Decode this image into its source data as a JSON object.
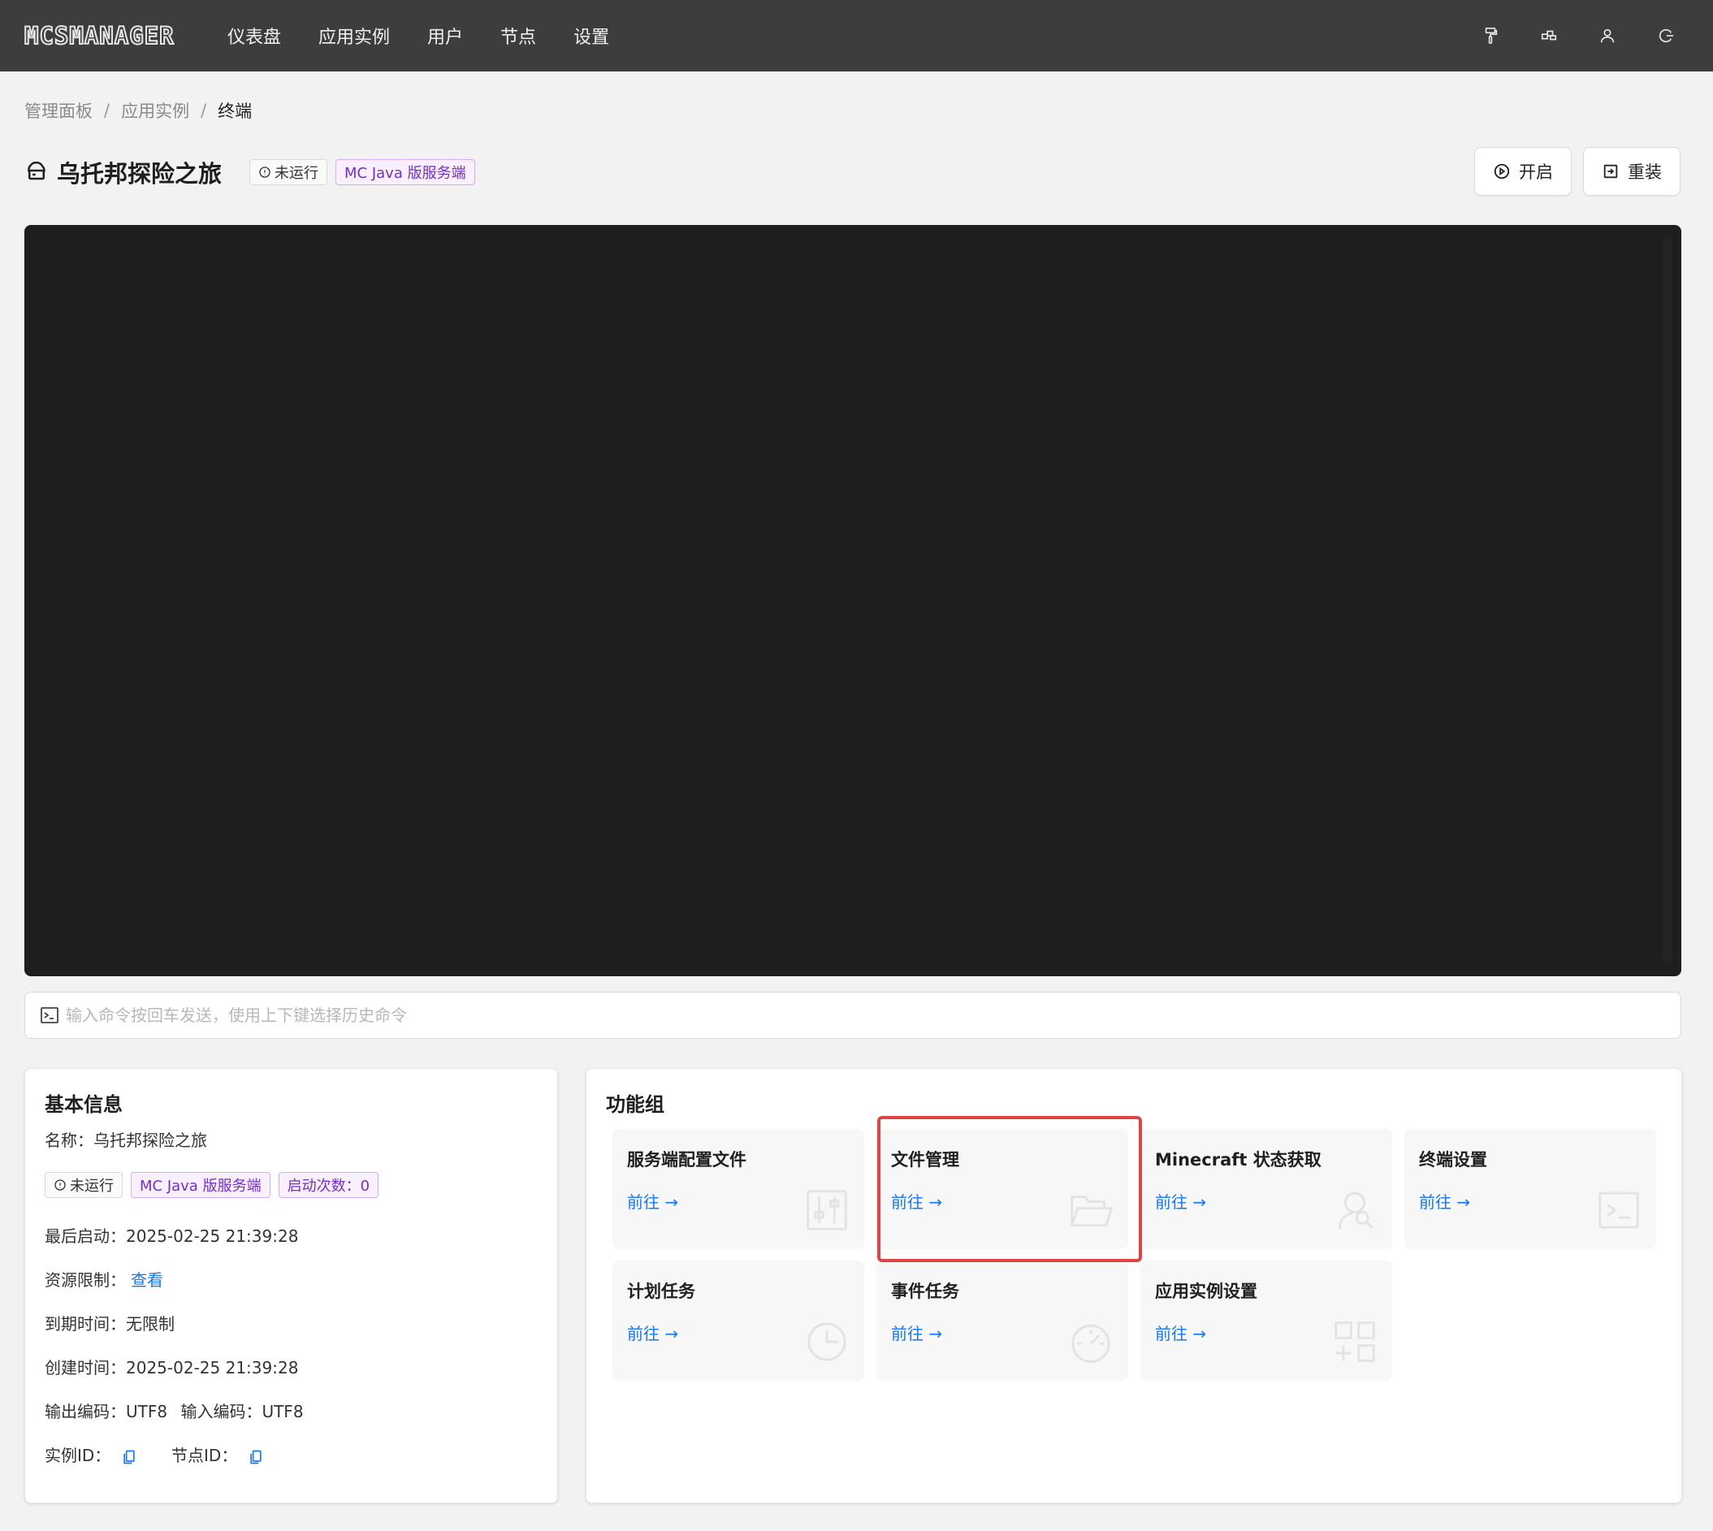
{
  "app": {
    "logo_text": "MCSMANAGER"
  },
  "nav": {
    "items": [
      "仪表盘",
      "应用实例",
      "用户",
      "节点",
      "设置"
    ],
    "right_icons": [
      "theme-brush-icon",
      "layout-icon",
      "user-icon",
      "logout-icon"
    ]
  },
  "breadcrumb": {
    "items": [
      "管理面板",
      "应用实例",
      "终端"
    ],
    "separator": "/"
  },
  "instance": {
    "title": "乌托邦探险之旅",
    "status": "未运行",
    "type": "MC Java 版服务端"
  },
  "actions": {
    "start_label": "开启",
    "reinstall_label": "重装"
  },
  "terminal": {
    "output": "",
    "placeholder": "输入命令按回车发送，使用上下键选择历史命令"
  },
  "info": {
    "title": "基本信息",
    "name_label": "名称：",
    "name_value": "乌托邦探险之旅",
    "status_tag": "未运行",
    "type_tag": "MC Java 版服务端",
    "starts_tag": "启动次数：0",
    "last_start_label": "最后启动：",
    "last_start_value": "2025-02-25 21:39:28",
    "limit_label": "资源限制：",
    "limit_link": "查看",
    "expire_label": "到期时间：",
    "expire_value": "无限制",
    "created_label": "创建时间：",
    "created_value": "2025-02-25 21:39:28",
    "out_enc_label": "输出编码：",
    "out_enc_value": "UTF8",
    "in_enc_label": "输入编码：",
    "in_enc_value": "UTF8",
    "instance_id_label": "实例ID：",
    "node_id_label": "节点ID："
  },
  "functions": {
    "title": "功能组",
    "go_label": "前往 →",
    "items": [
      {
        "title": "服务端配置文件",
        "icon": "sliders-icon"
      },
      {
        "title": "文件管理",
        "icon": "folder-open-icon"
      },
      {
        "title": "Minecraft 状态获取",
        "icon": "user-search-icon"
      },
      {
        "title": "终端设置",
        "icon": "terminal-icon"
      },
      {
        "title": "计划任务",
        "icon": "clock-icon"
      },
      {
        "title": "事件任务",
        "icon": "dashboard-icon"
      },
      {
        "title": "应用实例设置",
        "icon": "apps-icon"
      }
    ]
  },
  "colors": {
    "nav_bg": "#3d3d3d",
    "terminal_bg": "#1e1e1e",
    "link": "#1677ff",
    "highlight": "#e04545",
    "tag_purple": "#722ed1"
  }
}
